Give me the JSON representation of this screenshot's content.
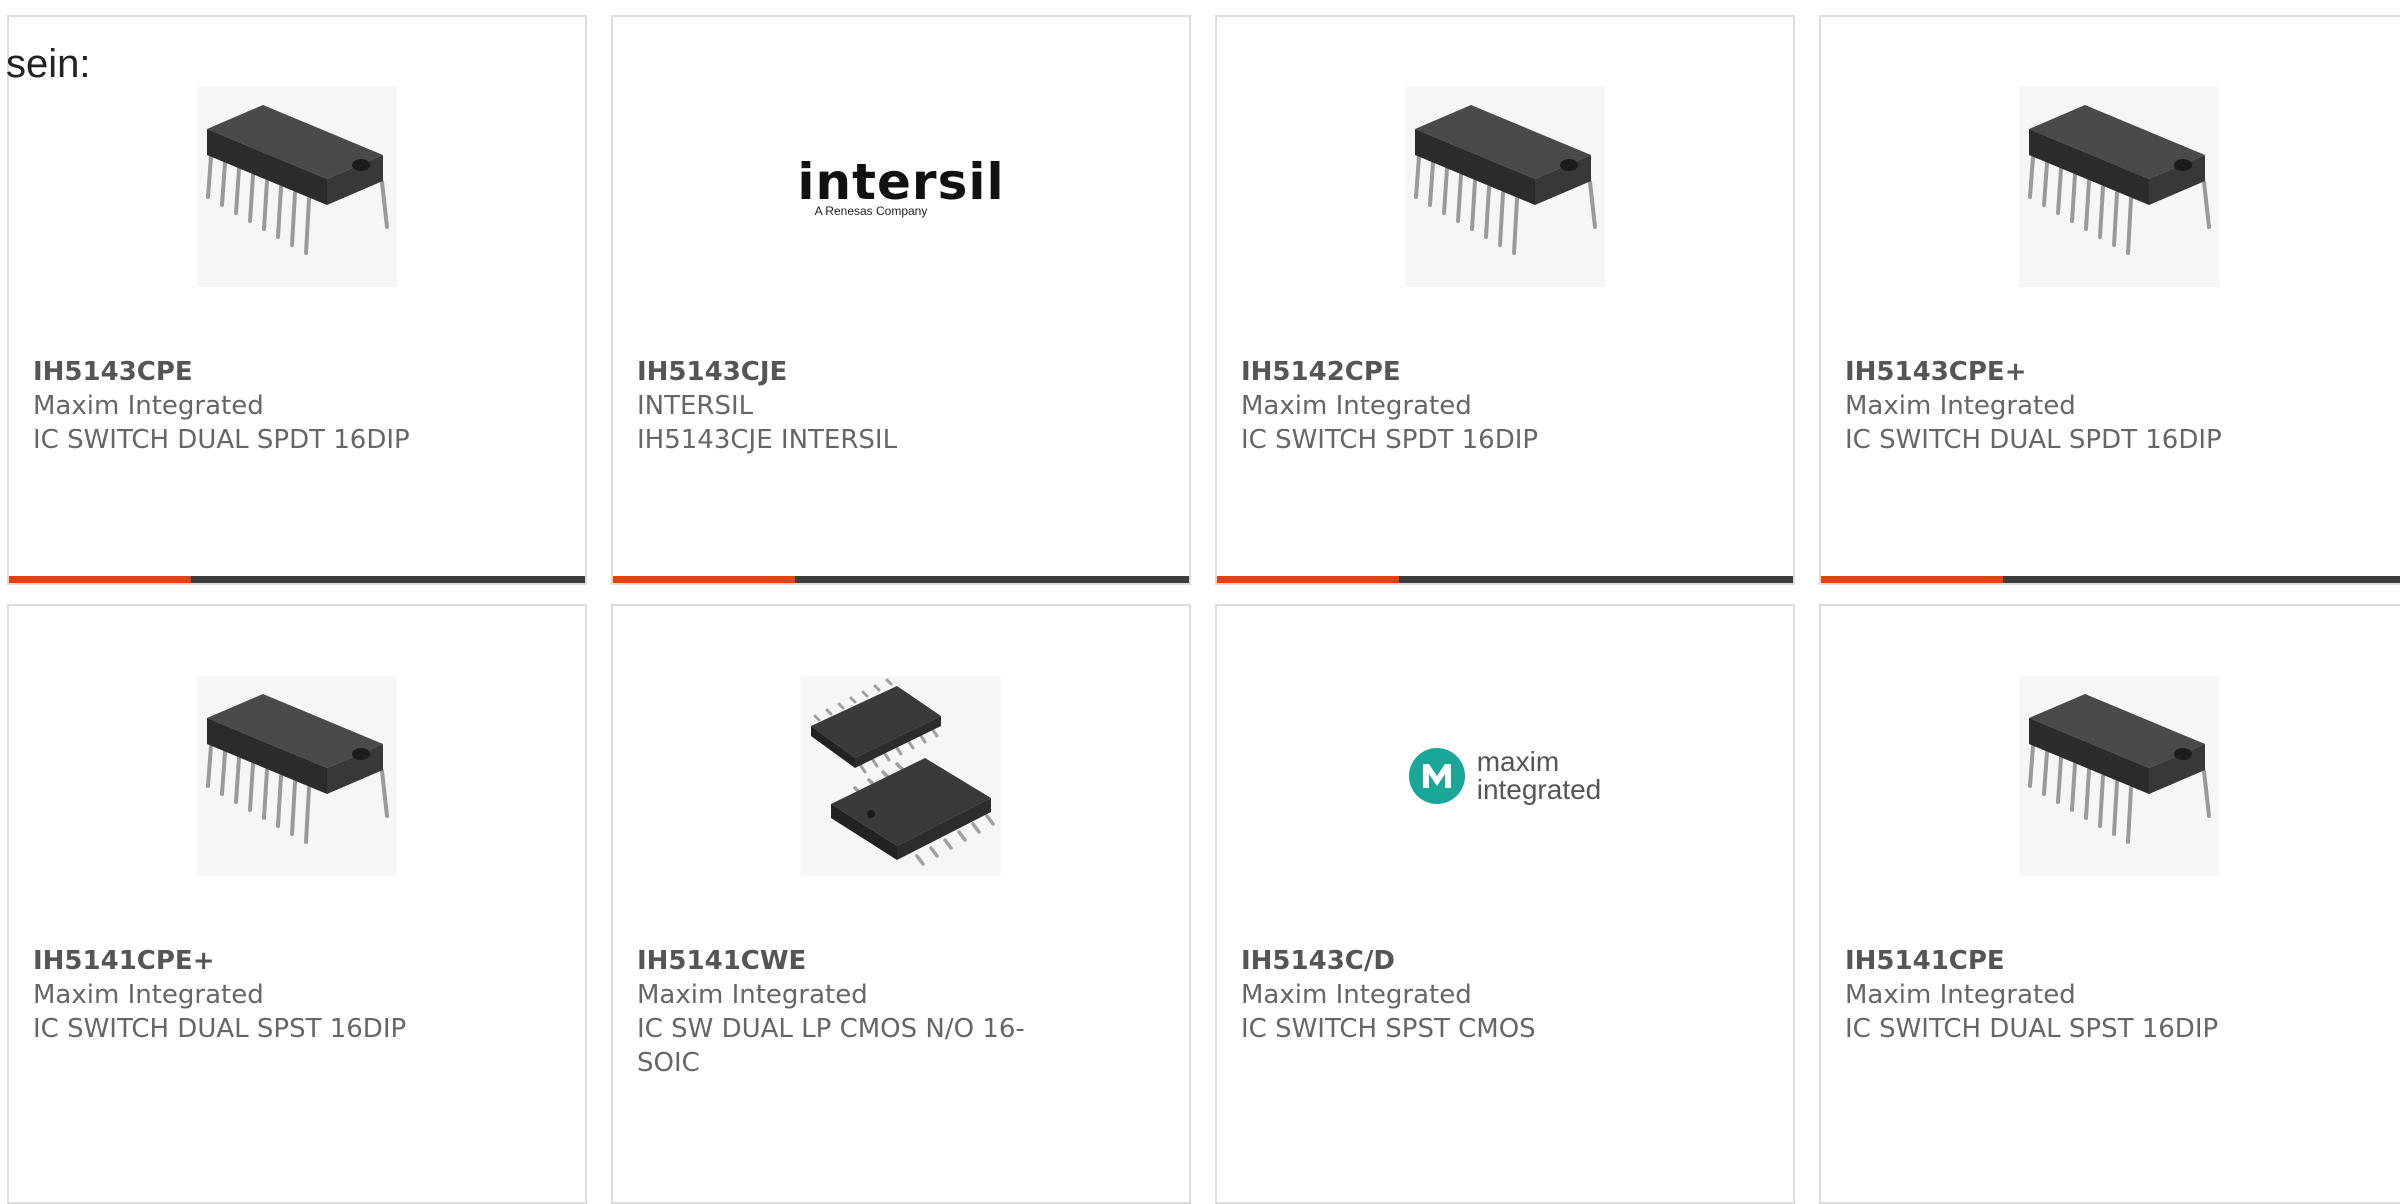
{
  "page_label": "sein:",
  "colors": {
    "accent": "#e8400c",
    "bar": "#3d3d3d",
    "border": "#dcdcdc",
    "maxim_teal": "#1aa79a"
  },
  "products": [
    {
      "part_number": "IH5143CPE",
      "manufacturer": "Maxim Integrated",
      "description": "IC SWITCH DUAL SPDT 16DIP",
      "image": "dip-16-chip-icon"
    },
    {
      "part_number": "IH5143CJE",
      "manufacturer": "INTERSIL",
      "description": "IH5143CJE INTERSIL",
      "image": "intersil-logo",
      "logo": {
        "word": "intersil",
        "tagline": "A Renesas Company"
      }
    },
    {
      "part_number": "IH5142CPE",
      "manufacturer": "Maxim Integrated",
      "description": "IC SWITCH SPDT 16DIP",
      "image": "dip-16-chip-icon"
    },
    {
      "part_number": "IH5143CPE+",
      "manufacturer": "Maxim Integrated",
      "description": "IC SWITCH DUAL SPDT 16DIP",
      "image": "dip-16-chip-icon"
    },
    {
      "part_number": "IH5141CPE+",
      "manufacturer": "Maxim Integrated",
      "description": "IC SWITCH DUAL SPST 16DIP",
      "image": "dip-16-chip-icon"
    },
    {
      "part_number": "IH5141CWE",
      "manufacturer": "Maxim Integrated",
      "description": "IC SW DUAL LP CMOS N/O 16-SOIC",
      "image": "soic-16-chip-icon"
    },
    {
      "part_number": "IH5143C/D",
      "manufacturer": "Maxim Integrated",
      "description": "IC SWITCH SPST CMOS",
      "image": "maxim-integrated-logo",
      "logo": {
        "line1": "maxim",
        "line2": "integrated"
      }
    },
    {
      "part_number": "IH5141CPE",
      "manufacturer": "Maxim Integrated",
      "description": "IC SWITCH DUAL SPST 16DIP",
      "image": "dip-16-chip-icon"
    }
  ]
}
